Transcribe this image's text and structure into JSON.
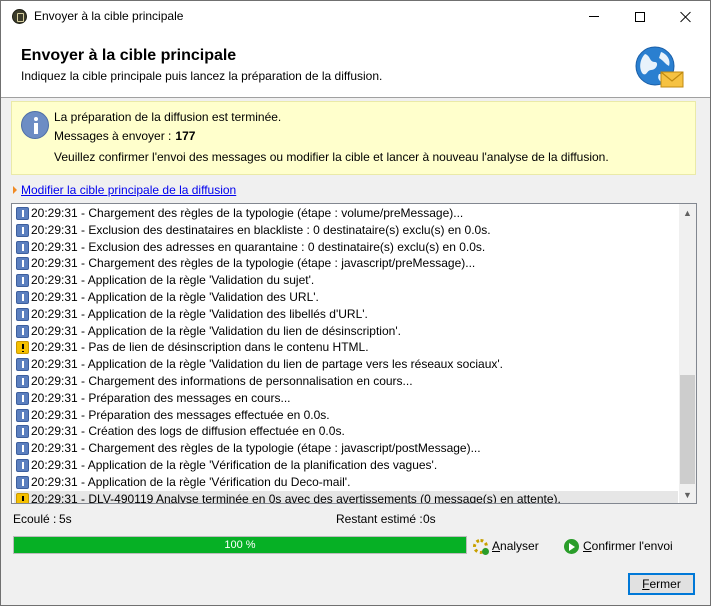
{
  "window": {
    "title": "Envoyer à la cible principale",
    "icon": "app-icon"
  },
  "header": {
    "title": "Envoyer à la cible principale",
    "subtitle": "Indiquez la cible principale puis lancez la préparation de la diffusion.",
    "icon": "globe-envelope-icon"
  },
  "info": {
    "line1": "La préparation de la diffusion est terminée.",
    "messages_label": "Messages à envoyer :",
    "messages_count": "177",
    "line3": "Veuillez confirmer l'envoi des messages ou modifier la cible et lancer à nouveau l'analyse de la diffusion."
  },
  "link": {
    "label": "Modifier la cible principale de la diffusion"
  },
  "log": {
    "rows": [
      {
        "type": "info",
        "text": "20:29:31 - Chargement des règles de la typologie (étape : volume/preMessage)..."
      },
      {
        "type": "info",
        "text": "20:29:31 - Exclusion des destinataires en blackliste : 0 destinataire(s) exclu(s) en 0.0s."
      },
      {
        "type": "info",
        "text": "20:29:31 - Exclusion des adresses en quarantaine : 0 destinataire(s) exclu(s) en 0.0s."
      },
      {
        "type": "info",
        "text": "20:29:31 - Chargement des règles de la typologie (étape : javascript/preMessage)..."
      },
      {
        "type": "info",
        "text": "20:29:31 - Application de la règle 'Validation du sujet'."
      },
      {
        "type": "info",
        "text": "20:29:31 - Application de la règle 'Validation des URL'."
      },
      {
        "type": "info",
        "text": "20:29:31 - Application de la règle 'Validation des libellés d'URL'."
      },
      {
        "type": "info",
        "text": "20:29:31 - Application de la règle 'Validation du lien de désinscription'."
      },
      {
        "type": "warning",
        "text": "20:29:31 - Pas de lien de désinscription dans le contenu HTML."
      },
      {
        "type": "info",
        "text": "20:29:31 - Application de la règle 'Validation du lien de partage vers les réseaux sociaux'."
      },
      {
        "type": "info",
        "text": "20:29:31 - Chargement des informations de personnalisation en cours..."
      },
      {
        "type": "info",
        "text": "20:29:31 - Préparation des messages en cours..."
      },
      {
        "type": "info",
        "text": "20:29:31 - Préparation des messages effectuée en 0.0s."
      },
      {
        "type": "info",
        "text": "20:29:31 - Création des logs de diffusion effectuée en 0.0s."
      },
      {
        "type": "info",
        "text": "20:29:31 - Chargement des règles de la typologie (étape : javascript/postMessage)..."
      },
      {
        "type": "info",
        "text": "20:29:31 - Application de la règle 'Vérification de la planification des vagues'."
      },
      {
        "type": "info",
        "text": "20:29:31 - Application de la règle 'Vérification du Deco-mail'."
      },
      {
        "type": "warning",
        "text": "20:29:31 - DLV-490119 Analyse terminée en 0s avec des avertissements (0 message(s) en attente)."
      }
    ]
  },
  "status": {
    "elapsed_label": "Ecoulé :",
    "elapsed_value": "5s",
    "remaining_label": "Restant estimé :",
    "remaining_value": "0s",
    "progress_text": "100 %",
    "progress_fraction": 1.0
  },
  "buttons": {
    "analyze_accel": "A",
    "analyze_rest": "nalyser",
    "confirm_accel": "C",
    "confirm_rest": "onfirmer l'envoi",
    "close_accel": "F",
    "close_rest": "ermer"
  },
  "colors": {
    "info_panel_bg": "#ffffcc",
    "progress_fill": "#06b025",
    "link": "#0000ee"
  }
}
